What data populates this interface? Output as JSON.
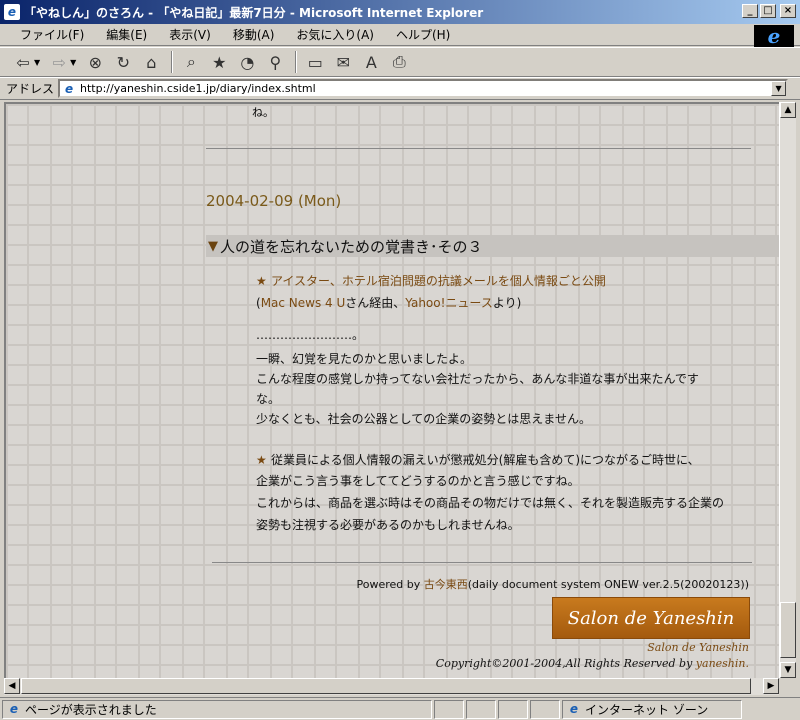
{
  "window": {
    "title": "「やねしん」のさろん - 「やね日記」最新7日分 - Microsoft Internet Explorer",
    "controls": [
      "_",
      "□",
      "×"
    ]
  },
  "menu": [
    "ファイル(F)",
    "編集(E)",
    "表示(V)",
    "移動(A)",
    "お気に入り(A)",
    "ヘルプ(H)"
  ],
  "address": {
    "label": "アドレス",
    "url": "http://yaneshin.cside1.jp/diary/index.shtml"
  },
  "page": {
    "top_fragment": "ね。",
    "date": "2004-02-09 (Mon)",
    "heading": "人の道を忘れないための覚書き･その３",
    "lines": [
      {
        "parts": [
          {
            "t": "★ ",
            "c": "star"
          },
          {
            "t": "アイスター、ホテル宿泊問題の抗議メールを個人情報ごと公開",
            "c": "link"
          }
        ]
      },
      {
        "parts": [
          {
            "t": "(",
            "c": ""
          },
          {
            "t": "Mac News 4 U",
            "c": "link"
          },
          {
            "t": "さん経由、",
            "c": ""
          },
          {
            "t": "Yahoo!ニュース",
            "c": "link"
          },
          {
            "t": "より)",
            "c": ""
          }
        ]
      },
      {
        "parts": [
          {
            "t": "  ……………………。",
            "c": "b"
          }
        ]
      },
      {
        "parts": [
          {
            "t": "  一瞬、",
            "c": ""
          },
          {
            "t": "幻覚",
            "c": "b"
          },
          {
            "t": "を見たのかと思いましたよ。",
            "c": ""
          }
        ]
      },
      {
        "parts": [
          {
            "t": "  ",
            "c": ""
          },
          {
            "t": "こんな程度の感覚",
            "c": "b"
          },
          {
            "t": "しか持ってない会社だったから、",
            "c": ""
          },
          {
            "t": "あんな非道な事",
            "c": "b"
          },
          {
            "t": "が出来たんです",
            "c": ""
          }
        ]
      },
      {
        "parts": [
          {
            "t": "な。",
            "c": ""
          }
        ]
      },
      {
        "parts": [
          {
            "t": "  少なくとも、",
            "c": ""
          },
          {
            "t": "社会の公器",
            "c": "b"
          },
          {
            "t": "としての企業の姿勢とは思えません。",
            "c": ""
          }
        ]
      },
      {
        "parts": [
          {
            "t": "★ ",
            "c": "star"
          },
          {
            "t": "従業員による",
            "c": ""
          },
          {
            "t": "個人情報の漏えい",
            "c": "b"
          },
          {
            "t": "が",
            "c": ""
          },
          {
            "t": "懲戒処分",
            "c": "b"
          },
          {
            "t": "(",
            "c": ""
          },
          {
            "t": "解雇",
            "c": "b"
          },
          {
            "t": "も含めて)につながるご時世に、",
            "c": ""
          }
        ]
      },
      {
        "parts": [
          {
            "t": "企業がこう言う事をしててどうするのかと言う感じですね。",
            "c": ""
          }
        ]
      },
      {
        "parts": [
          {
            "t": "  これからは、商品を選ぶ時はその商品その物だけでは無く、それを製造販売する",
            "c": ""
          },
          {
            "t": "企業の",
            "c": "b"
          }
        ]
      },
      {
        "parts": [
          {
            "t": "姿勢",
            "c": "b"
          },
          {
            "t": "も注視する必要があるのかもしれませんね。",
            "c": ""
          }
        ]
      }
    ],
    "powered_prefix": "Powered by ",
    "powered_link": "古今東西",
    "powered_suffix": "(daily document system ONEW ver.2.5(20020123))",
    "logo_text": "Salon de Yaneshin",
    "logo_caption": "Salon de Yaneshin",
    "copyright_prefix": "Copyright©2001-2004,All Rights Reserved by ",
    "copyright_author": "yaneshin."
  },
  "status": {
    "message": "ページが表示されました",
    "zone": "インターネット ゾーン"
  }
}
